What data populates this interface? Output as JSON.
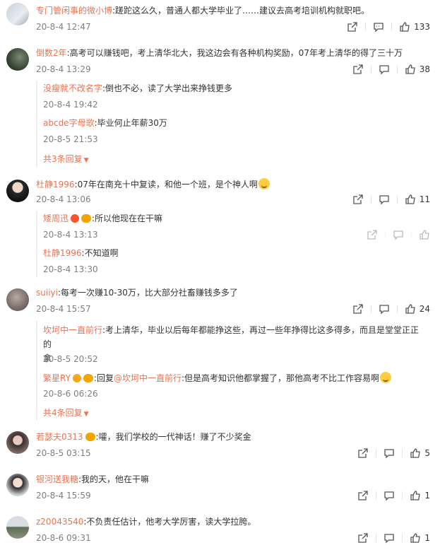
{
  "comments": [
    {
      "user": "专门管闲事的微小博",
      "text": ":蹉跎这么久，普通人都大学毕业了……建议去高考培训机构就职吧。",
      "time": "20-8-4 12:47",
      "likes": "133"
    },
    {
      "user": "倒数2年",
      "text": ":高考可以赚钱吧，考上清华北大，我这边会有各种机构奖励，07年考上清华的得了三十万",
      "time": "20-8-4 13:29",
      "likes": "38",
      "replies": [
        {
          "user": "没瘦就不改名字",
          "text": ":倒也不必，读了大学出来挣钱更多",
          "time": "20-8-4 19:42"
        },
        {
          "user": "abcde字母歌",
          "text": ":毕业何止年薪30万",
          "time": "20-8-5 21:53"
        }
      ],
      "more": "共3条回复"
    },
    {
      "user": "杜静1996",
      "text": ":07年在南充十中复读，和他一个班，是个神人啊",
      "time": "20-8-4 13:06",
      "likes": "11",
      "replies": [
        {
          "user": "矮周迅",
          "text": ":所以他现在在干嘛",
          "time": "20-8-4 13:13"
        },
        {
          "user": "杜静1996",
          "text": ":不知道啊",
          "time": "20-8-4 13:30"
        }
      ]
    },
    {
      "user": "suiiyi",
      "text": ":每考一次赚10-30万，比大部分社畜赚钱多多了",
      "time": "20-8-4 15:57",
      "likes": "24",
      "replies": [
        {
          "user": "坎坷中一直前行",
          "text": ":考上清华，毕业以后每年都能挣这些，再过一些年挣得比这多得多，而且是堂堂正正的",
          "text2": "拿",
          "time": "20-8-5 20:52"
        },
        {
          "user": "繁星RY",
          "reply_prefix": ":回复",
          "reply_to": "@坎坷中一直前行",
          "text": ":但是高考知识他都掌握了，那他高考不比工作容易啊",
          "time": "20-8-6 06:26"
        }
      ],
      "more": "共4条回复"
    },
    {
      "user": "若瑟夫0313",
      "text": ":嚯，我们学校的一代神话！赚了不少奖金",
      "time": "20-8-5 03:15",
      "likes": "5"
    },
    {
      "user": "银河送我糖",
      "text": ":我的天，他在干嘛",
      "time": "20-8-4 15:59",
      "likes": "1"
    },
    {
      "user": "z20043540",
      "text": ":不负责任估计，他考大学厉害，读大学拉胯。",
      "time": "20-8-6 09:31",
      "likes": "1"
    }
  ],
  "icons": {
    "share": "share-icon",
    "reply": "comment-icon",
    "like": "thumbs-up-icon",
    "more": "chevron-down-icon"
  },
  "colors": {
    "username": "#eb7350",
    "text": "#333333",
    "meta": "#808080"
  }
}
